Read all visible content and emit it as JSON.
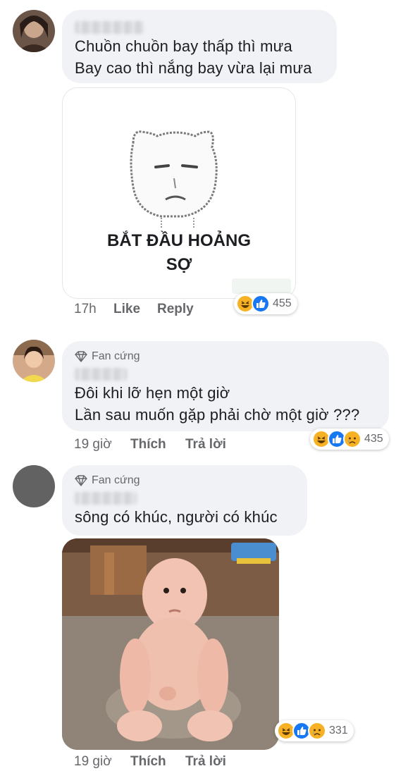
{
  "comments": [
    {
      "text": "Chuồn chuồn bay thấp thì mưa\nBay cao thì nắng bay vừa lại mưa",
      "sticker_caption": "BẮT ĐẦU HOẢNG\nSỢ",
      "time": "17h",
      "like_label": "Like",
      "reply_label": "Reply",
      "reactions": [
        "haha",
        "like"
      ],
      "reaction_count": "455"
    },
    {
      "badge": "Fan cứng",
      "text": "Đôi khi lỡ hẹn một giờ\nLần sau muốn gặp phải chờ một giờ ???",
      "time": "19 giờ",
      "like_label": "Thích",
      "reply_label": "Trả lời",
      "reactions": [
        "haha",
        "like",
        "sad"
      ],
      "reaction_count": "435"
    },
    {
      "badge": "Fan cứng",
      "text": "sông có khúc, người có khúc",
      "time": "19 giờ",
      "like_label": "Thích",
      "reply_label": "Trả lời",
      "reactions": [
        "haha",
        "like",
        "sad"
      ],
      "reaction_count": "331"
    }
  ],
  "colors": {
    "bubble": "#f0f2f5",
    "meta_text": "#65676b",
    "like_blue": "#1877f2",
    "haha_yellow": "#f7b125"
  },
  "icons": [
    "diamond-icon",
    "haha-reaction-icon",
    "like-reaction-icon",
    "sad-reaction-icon"
  ]
}
